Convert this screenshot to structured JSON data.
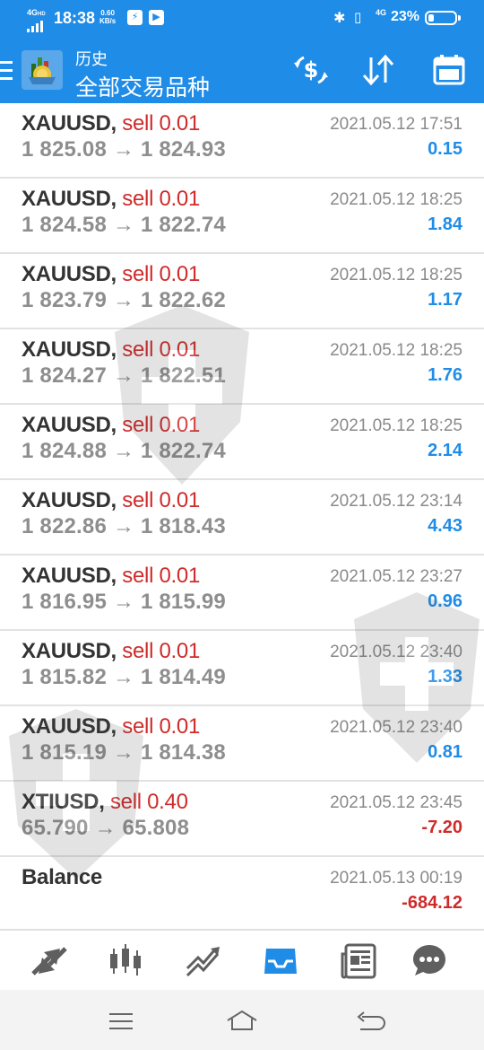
{
  "status_bar": {
    "network": "4G",
    "network_hd": "HD",
    "time": "18:38",
    "speed_value": "0.60",
    "speed_unit": "KB/s",
    "net_type": "4G",
    "battery": "23%"
  },
  "app_bar": {
    "subtitle": "历史",
    "title": "全部交易品种"
  },
  "trades": [
    {
      "symbol": "XAUUSD,",
      "side": "sell 0.01",
      "prices": "1 825.08 → 1 824.93",
      "time": "2021.05.12 17:51",
      "profit": "0.15",
      "profit_sign": "pos"
    },
    {
      "symbol": "XAUUSD,",
      "side": "sell 0.01",
      "prices": "1 824.58 → 1 822.74",
      "time": "2021.05.12 18:25",
      "profit": "1.84",
      "profit_sign": "pos"
    },
    {
      "symbol": "XAUUSD,",
      "side": "sell 0.01",
      "prices": "1 823.79 → 1 822.62",
      "time": "2021.05.12 18:25",
      "profit": "1.17",
      "profit_sign": "pos"
    },
    {
      "symbol": "XAUUSD,",
      "side": "sell 0.01",
      "prices": "1 824.27 → 1 822.51",
      "time": "2021.05.12 18:25",
      "profit": "1.76",
      "profit_sign": "pos"
    },
    {
      "symbol": "XAUUSD,",
      "side": "sell 0.01",
      "prices": "1 824.88 → 1 822.74",
      "time": "2021.05.12 18:25",
      "profit": "2.14",
      "profit_sign": "pos"
    },
    {
      "symbol": "XAUUSD,",
      "side": "sell 0.01",
      "prices": "1 822.86 → 1 818.43",
      "time": "2021.05.12 23:14",
      "profit": "4.43",
      "profit_sign": "pos"
    },
    {
      "symbol": "XAUUSD,",
      "side": "sell 0.01",
      "prices": "1 816.95 → 1 815.99",
      "time": "2021.05.12 23:27",
      "profit": "0.96",
      "profit_sign": "pos"
    },
    {
      "symbol": "XAUUSD,",
      "side": "sell 0.01",
      "prices": "1 815.82 → 1 814.49",
      "time": "2021.05.12 23:40",
      "profit": "1.33",
      "profit_sign": "pos"
    },
    {
      "symbol": "XAUUSD,",
      "side": "sell 0.01",
      "prices": "1 815.19 → 1 814.38",
      "time": "2021.05.12 23:40",
      "profit": "0.81",
      "profit_sign": "pos"
    },
    {
      "symbol": "XTIUSD,",
      "side": "sell 0.40",
      "prices": "65.790 → 65.808",
      "time": "2021.05.12 23:45",
      "profit": "-7.20",
      "profit_sign": "neg"
    }
  ],
  "balance": {
    "label": "Balance",
    "time": "2021.05.13 00:19",
    "amount": "-684.12"
  },
  "bottom_nav": {
    "active": "history",
    "items": [
      "quotes-icon",
      "chart-icon",
      "trade-icon",
      "history-icon",
      "news-icon",
      "chat-icon"
    ]
  },
  "colors": {
    "header": "#1f8ce8",
    "sell": "#cf2b2b",
    "profit_positive": "#1f8ce8",
    "profit_negative": "#cf2b2b",
    "nav_inactive": "#5f5f5f"
  }
}
